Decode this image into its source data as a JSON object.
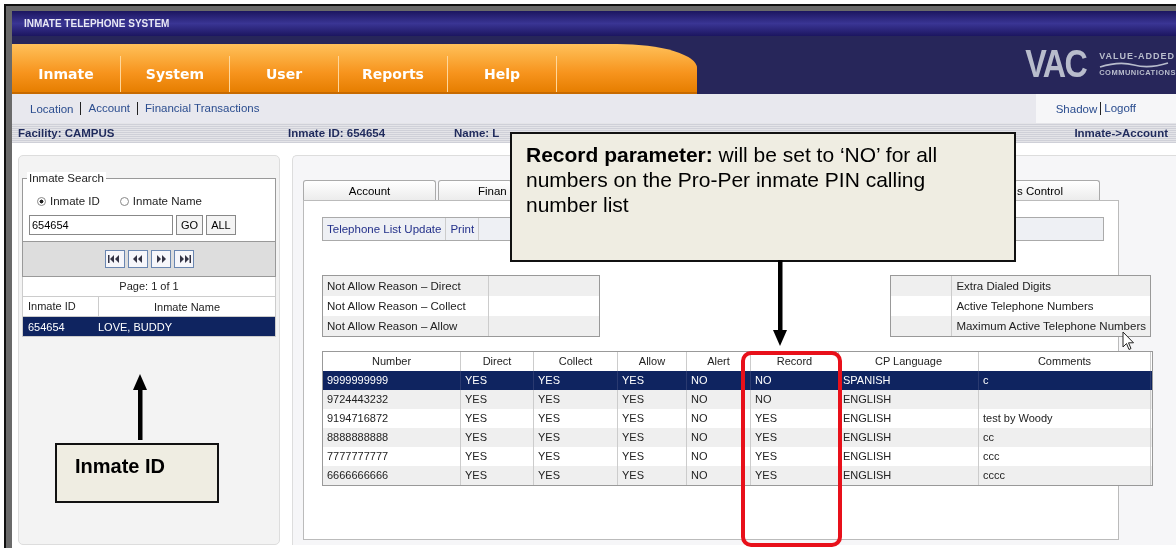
{
  "app_title": "INMATE TELEPHONE SYSTEM",
  "menu": [
    {
      "label": "Inmate"
    },
    {
      "label": "System"
    },
    {
      "label": "User"
    },
    {
      "label": "Reports"
    },
    {
      "label": "Help"
    }
  ],
  "logo": {
    "mark": "VAC",
    "line1": "VALUE-ADDED",
    "line2": "COMMUNICATIONS"
  },
  "subnav": [
    "Location",
    "Account",
    "Financial Transactions"
  ],
  "user_links": [
    "Shadow",
    "Logoff"
  ],
  "info_bar": {
    "facility": "Facility: CAMPUS",
    "inmate_id": "Inmate ID: 654654",
    "name": "Name: L",
    "breadcrumb": "Inmate->Account"
  },
  "search": {
    "title": "Inmate Search",
    "options": [
      {
        "label": "Inmate ID",
        "selected": true
      },
      {
        "label": "Inmate Name",
        "selected": false
      }
    ],
    "value": "654654",
    "buttons": [
      "GO",
      "ALL"
    ],
    "page": "Page: 1 of 1",
    "columns": [
      "Inmate ID",
      "Inmate Name"
    ],
    "rows": [
      {
        "cells": [
          "654654",
          "LOVE, BUDDY"
        ],
        "selected": true
      }
    ]
  },
  "tabs": [
    "Account",
    "Finan",
    "s Control"
  ],
  "subtabs": [
    "Telephone List Update",
    "Print"
  ],
  "reasons": [
    "Not Allow Reason – Direct",
    "Not Allow Reason – Collect",
    "Not Allow Reason – Allow"
  ],
  "counts": [
    "Extra Dialed Digits",
    "Active Telephone Numbers",
    "Maximum Active Telephone Numbers"
  ],
  "table": {
    "columns": [
      "Number",
      "Direct",
      "Collect",
      "Allow",
      "Alert",
      "Record",
      "CP Language",
      "Comments"
    ],
    "rows": [
      {
        "cells": [
          "9999999999",
          "YES",
          "YES",
          "YES",
          "NO",
          "NO",
          "SPANISH",
          "c"
        ],
        "selected": true
      },
      {
        "cells": [
          "9724443232",
          "YES",
          "YES",
          "YES",
          "NO",
          "NO",
          "ENGLISH",
          ""
        ],
        "selected": false
      },
      {
        "cells": [
          "9194716872",
          "YES",
          "YES",
          "YES",
          "NO",
          "YES",
          "ENGLISH",
          "test by Woody"
        ],
        "selected": false
      },
      {
        "cells": [
          "8888888888",
          "YES",
          "YES",
          "YES",
          "NO",
          "YES",
          "ENGLISH",
          "cc"
        ],
        "selected": false
      },
      {
        "cells": [
          "7777777777",
          "YES",
          "YES",
          "YES",
          "NO",
          "YES",
          "ENGLISH",
          "ccc"
        ],
        "selected": false
      },
      {
        "cells": [
          "6666666666",
          "YES",
          "YES",
          "YES",
          "NO",
          "YES",
          "ENGLISH",
          "cccc"
        ],
        "selected": false
      }
    ]
  },
  "callouts": [
    {
      "text": "**Record parameter:** will be set to ‘NO’ for all numbers on the Pro-Per inmate PIN calling number list"
    },
    {
      "text": "Inmate ID"
    }
  ]
}
